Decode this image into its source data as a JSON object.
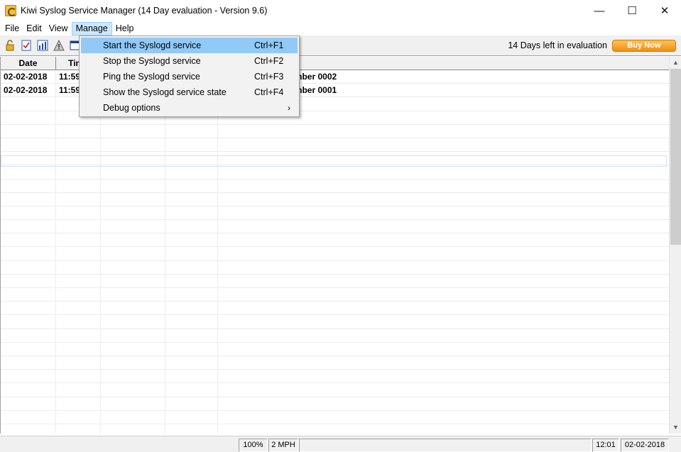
{
  "window": {
    "title": "Kiwi Syslog Service Manager (14 Day evaluation - Version 9.6)",
    "minimize": "—",
    "maximize": "☐",
    "close": "✕"
  },
  "menubar": {
    "items": [
      "File",
      "Edit",
      "View",
      "Manage",
      "Help"
    ],
    "active": "Manage"
  },
  "toolbar": {
    "icons": [
      "lock-icon",
      "checklist-icon",
      "chart-icon",
      "warning-icon",
      "window-icon"
    ],
    "evaluation_text": "14 Days left in evaluation",
    "buy_label": "Buy Now",
    "buy_color": "#f39a1e"
  },
  "grid": {
    "columns": [
      "Date",
      "Time",
      "",
      "",
      ""
    ],
    "rows": [
      {
        "date": "02-02-2018",
        "time": "11:59",
        "col3": "",
        "col4": "",
        "message": "- Test message number 0002"
      },
      {
        "date": "02-02-2018",
        "time": "11:59",
        "col3": "",
        "col4": "",
        "message": "- Test message number 0001"
      }
    ]
  },
  "manage_menu": {
    "items": [
      {
        "label": "Start the Syslogd service",
        "shortcut": "Ctrl+F1",
        "highlighted": true
      },
      {
        "label": "Stop the Syslogd service",
        "shortcut": "Ctrl+F2"
      },
      {
        "label": "Ping the Syslogd service",
        "shortcut": "Ctrl+F3"
      },
      {
        "label": "Show the Syslogd service state",
        "shortcut": "Ctrl+F4"
      },
      {
        "label": "Debug options",
        "shortcut": "",
        "submenu_arrow": "›"
      }
    ],
    "highlight_color": "#91c9f7"
  },
  "statusbar": {
    "zoom": "100%",
    "rate": "2 MPH",
    "time": "12:01",
    "date": "02-02-2018"
  }
}
